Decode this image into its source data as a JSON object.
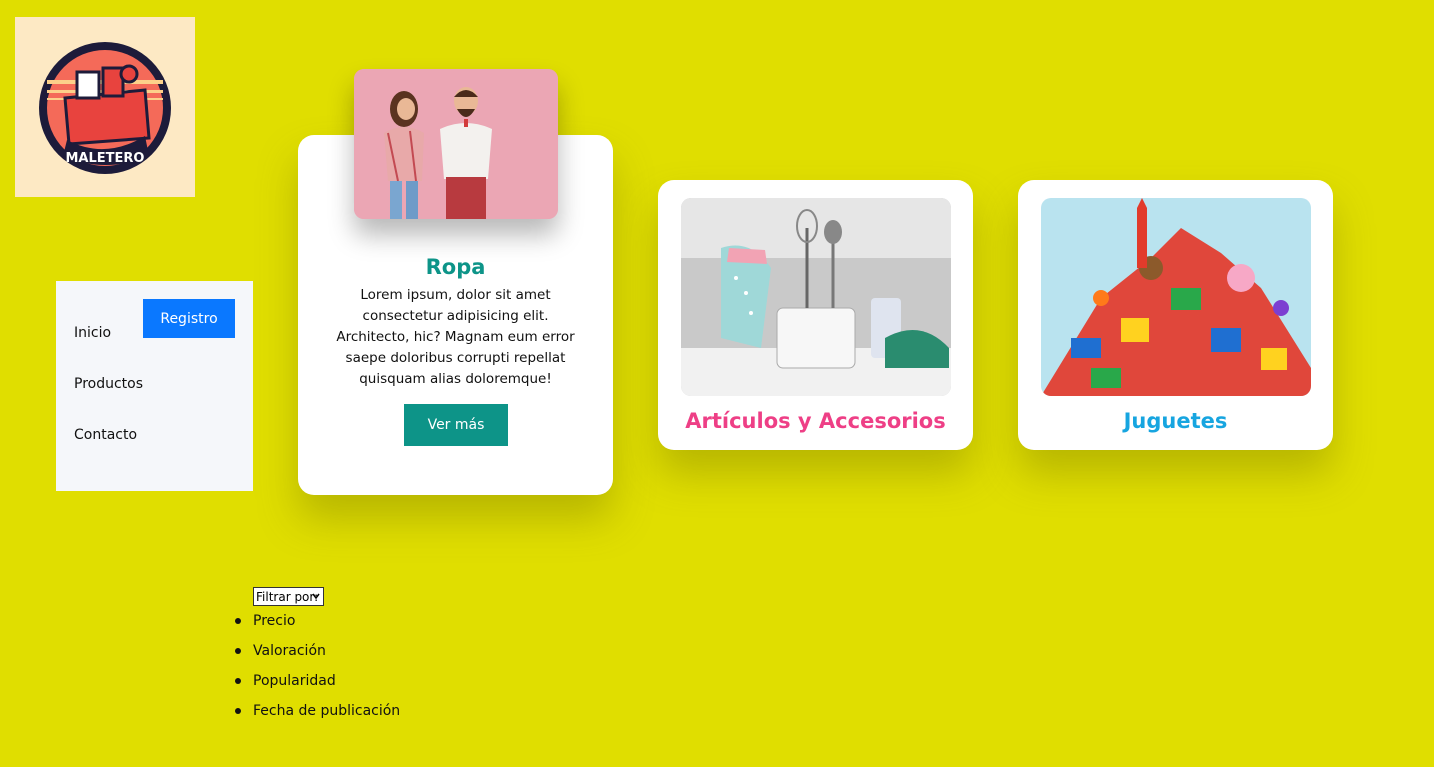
{
  "logo": {
    "text": "MALETERO",
    "icon": "suitcase-badge-icon"
  },
  "nav": {
    "register": "Registro",
    "home": "Inicio",
    "products": "Productos",
    "contact": "Contacto"
  },
  "cards": [
    {
      "title": "Ropa",
      "text": "Lorem ipsum, dolor sit amet consectetur adipisicing elit. Architecto, hic? Magnam eum error saepe doloribus corrupti repellat quisquam alias doloremque!",
      "button": "Ver más",
      "color": "#0d9488"
    },
    {
      "title": "Artículos y Accesorios",
      "color": "#ee3f86"
    },
    {
      "title": "Juguetes",
      "color": "#17a5e0"
    }
  ],
  "filter": {
    "select_label": "Filtrar por:",
    "options": [
      "Precio",
      "Valoración",
      "Popularidad",
      "Fecha de publicación"
    ]
  },
  "colors": {
    "background": "#e0de00",
    "register": "#0a78ff"
  }
}
